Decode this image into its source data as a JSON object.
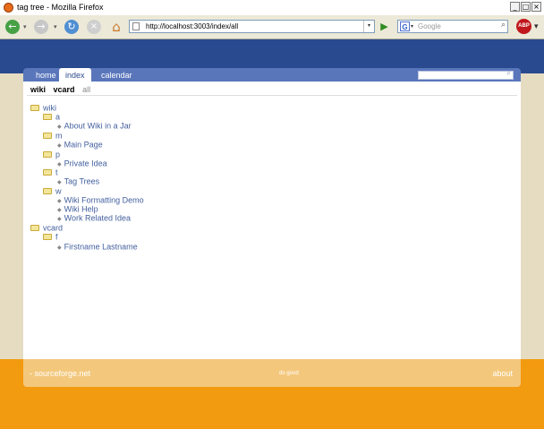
{
  "window": {
    "title": "tag tree - Mozilla Firefox",
    "controls": [
      "_",
      "□",
      "×"
    ]
  },
  "toolbar": {
    "back_glyph": "←",
    "forward_glyph": "→",
    "dropdown_glyph": "▾",
    "reload_glyph": "↻",
    "stop_glyph": "×",
    "home_glyph": "⌂",
    "url": "http://localhost:3003/index/all",
    "go_glyph": "▶",
    "search_engine_glyph": "G",
    "search_placeholder": "Google",
    "search_icon": "magnifier-icon",
    "abp_label": "ABP"
  },
  "app": {
    "tabs": [
      {
        "label": "home",
        "active": false
      },
      {
        "label": "index",
        "active": true
      },
      {
        "label": "calendar",
        "active": false
      }
    ],
    "subnav": [
      {
        "label": "wiki",
        "selected": true
      },
      {
        "label": "vcard",
        "selected": true
      },
      {
        "label": "all",
        "selected": false
      }
    ],
    "tree": [
      {
        "type": "folder",
        "label": "wiki"
      },
      {
        "type": "folder",
        "label": "a"
      },
      {
        "type": "page",
        "label": "About Wiki in a Jar"
      },
      {
        "type": "folder",
        "label": "m"
      },
      {
        "type": "page",
        "label": "Main Page"
      },
      {
        "type": "folder",
        "label": "p"
      },
      {
        "type": "page",
        "label": "Private Idea"
      },
      {
        "type": "folder",
        "label": "t"
      },
      {
        "type": "page",
        "label": "Tag Trees"
      },
      {
        "type": "folder",
        "label": "w"
      },
      {
        "type": "page",
        "label": "Wiki Formatting Demo"
      },
      {
        "type": "page",
        "label": "Wiki Help"
      },
      {
        "type": "page",
        "label": "Work Related Idea"
      },
      {
        "type": "folder",
        "label": "vcard"
      },
      {
        "type": "folder",
        "label": "f"
      },
      {
        "type": "page",
        "label": "Firstname Lastname"
      }
    ],
    "footer": {
      "left": "- sourceforge.net",
      "middle": "do good",
      "right": "about"
    }
  },
  "colors": {
    "nav_blue": "#2a4a8f",
    "tab_blue": "#5a76bb",
    "orange": "#f29a10",
    "link": "#44609f"
  }
}
